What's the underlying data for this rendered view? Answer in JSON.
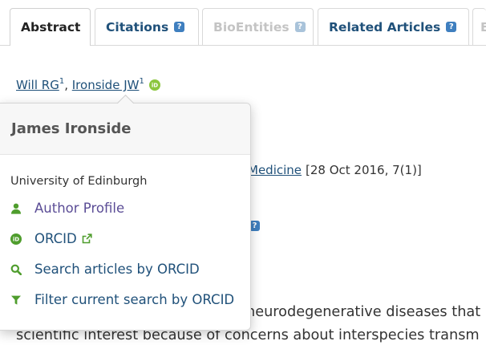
{
  "tabs": [
    {
      "label": "Abstract",
      "active": true,
      "disabled": false,
      "help": false
    },
    {
      "label": "Citations",
      "active": false,
      "disabled": false,
      "help": true
    },
    {
      "label": "BioEntities",
      "active": false,
      "disabled": true,
      "help": true
    },
    {
      "label": "Related Articles",
      "active": false,
      "disabled": false,
      "help": true
    },
    {
      "label": "E",
      "active": false,
      "disabled": true,
      "help": false
    }
  ],
  "help_badge_glyph": "?",
  "authors": {
    "list": [
      {
        "name": "Will RG",
        "affiliation_ref": "1"
      },
      {
        "name": "Ironside JW",
        "affiliation_ref": "1"
      }
    ],
    "separator": ", ",
    "orcid_icon_text": "iD"
  },
  "author_popover": {
    "name": "James Ironside",
    "affiliation": "University of Edinburgh",
    "actions": [
      {
        "label": "Author Profile",
        "icon": "user-icon"
      },
      {
        "label": "ORCID",
        "icon": "orcid-icon",
        "trailing_icon": "external-link-icon"
      },
      {
        "label": "Search articles by ORCID",
        "icon": "search-icon"
      },
      {
        "label": "Filter current search by ORCID",
        "icon": "filter-icon"
      }
    ]
  },
  "article": {
    "journal_link": "Medicine",
    "publication_info": "[28 Oct 2016, 7(1)]",
    "abstract_fragments": [
      "neurodegenerative diseases that",
      "scientific interest because of concerns about interspecies transm"
    ]
  },
  "colors": {
    "link": "#20517a",
    "visited_link": "#5b4d96",
    "icon_green": "#4f9d2d",
    "orcid_green": "#8cc63f",
    "help_badge": "#3f7fbf",
    "help_badge_disabled": "#a9c3da",
    "disabled_text": "#c4c4c4"
  }
}
